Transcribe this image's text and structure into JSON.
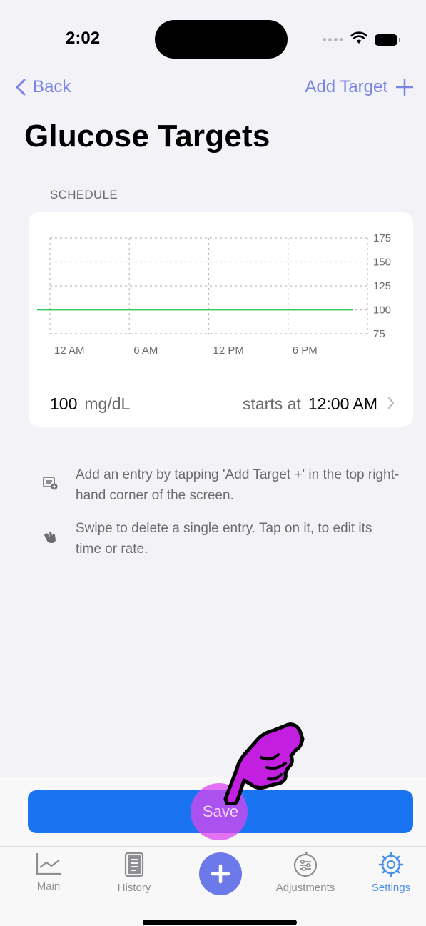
{
  "status_bar": {
    "time": "2:02"
  },
  "nav": {
    "back_label": "Back",
    "add_label": "Add Target"
  },
  "page": {
    "title": "Glucose Targets",
    "section_header": "SCHEDULE"
  },
  "chart_data": {
    "type": "line",
    "x_tick_labels": [
      "12 AM",
      "6 AM",
      "12 PM",
      "6 PM"
    ],
    "y_tick_labels": [
      "175",
      "150",
      "125",
      "100",
      "75"
    ],
    "ylim": [
      75,
      175
    ],
    "grid": true,
    "series": [
      {
        "x": [
          "12 AM",
          "6 PM"
        ],
        "values": [
          100,
          100
        ],
        "color": "#34c759"
      }
    ]
  },
  "entry": {
    "value": "100",
    "unit": "mg/dL",
    "starts_label": "starts at",
    "time": "12:00 AM"
  },
  "help": {
    "add_text": "Add an entry by tapping 'Add Target +' in the top right-hand corner of the screen.",
    "swipe_text": "Swipe to delete a single entry. Tap on it, to edit its time or rate."
  },
  "save_label": "Save",
  "tabs": [
    {
      "label": "Main",
      "icon": "chart-icon"
    },
    {
      "label": "History",
      "icon": "document-icon"
    },
    {
      "label": "",
      "icon": "plus-icon"
    },
    {
      "label": "Adjustments",
      "icon": "adjustments-icon"
    },
    {
      "label": "Settings",
      "icon": "gear-icon"
    }
  ],
  "colors": {
    "accent": "#7a83e6",
    "save": "#1a73f0",
    "target_line": "#34c759",
    "settings_active": "#4a8fe8"
  }
}
